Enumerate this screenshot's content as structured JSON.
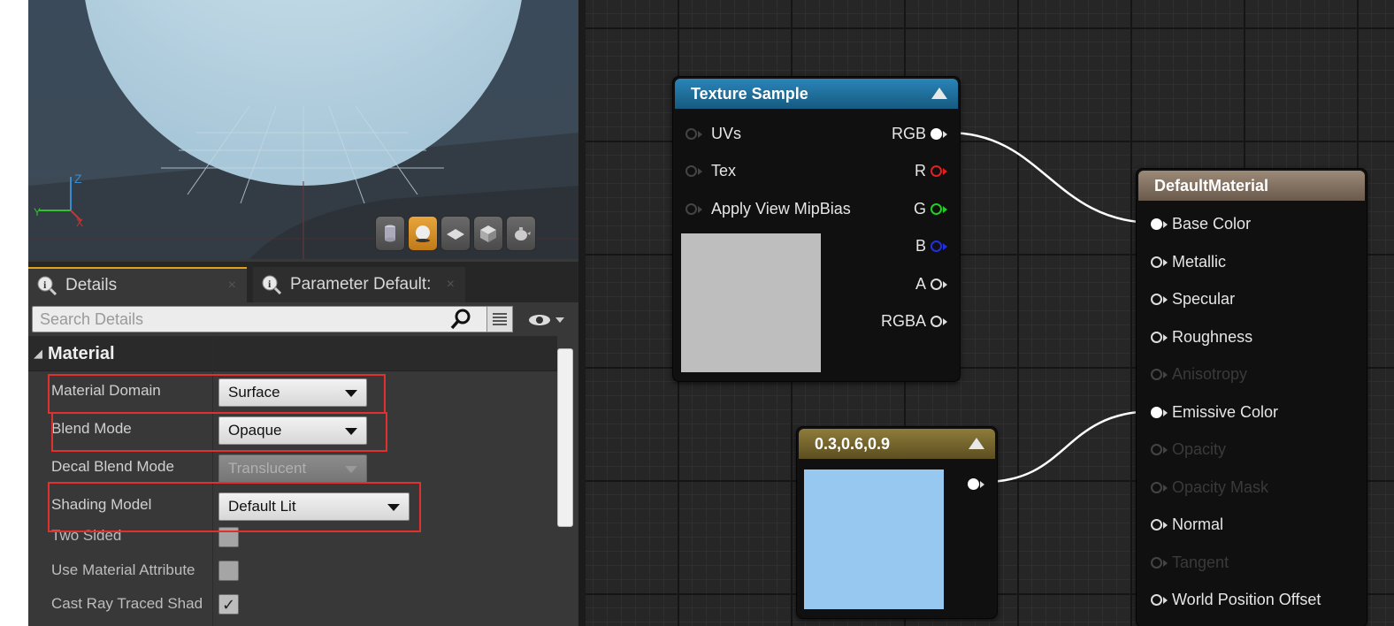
{
  "details_panel": {
    "tabs": [
      {
        "label": "Details"
      },
      {
        "label": "Parameter Default:"
      }
    ],
    "search": {
      "placeholder": "Search Details"
    },
    "section": {
      "title": "Material"
    },
    "properties": [
      {
        "label": "Material Domain",
        "value": "Surface",
        "highlighted": true
      },
      {
        "label": "Blend Mode",
        "value": "Opaque",
        "highlighted": true
      },
      {
        "label": "Decal Blend Mode",
        "value": "Translucent",
        "disabled": true
      },
      {
        "label": "Shading Model",
        "value": "Default Lit",
        "highlighted": true
      },
      {
        "label": "Two Sided",
        "checked": false
      },
      {
        "label": "Use Material Attribute",
        "checked": false
      },
      {
        "label": "Cast Ray Traced Shad",
        "checked": true
      }
    ],
    "highlight_color": "#e03030",
    "viewport_axes": {
      "z": "Z",
      "y": "Y",
      "x": "X"
    }
  },
  "nodes": {
    "texture_sample": {
      "title": "Texture Sample",
      "header_color": "#1f6f9a",
      "inputs": [
        "UVs",
        "Tex",
        "Apply View MipBias"
      ],
      "outputs": [
        {
          "label": "RGB",
          "color": "#ffffff"
        },
        {
          "label": "R",
          "color": "#e02020"
        },
        {
          "label": "G",
          "color": "#20d020"
        },
        {
          "label": "B",
          "color": "#2030e0"
        },
        {
          "label": "A",
          "color": "#d0d0d0"
        },
        {
          "label": "RGBA",
          "color": "#d0d0d0"
        }
      ],
      "preview_color": "#bebebe"
    },
    "constant": {
      "title": "0.3,0.6,0.9",
      "header_color": "#7a6a30",
      "preview_color": "#97c8f0"
    },
    "default_material": {
      "title": "DefaultMaterial",
      "header_color": "#8a7868",
      "inputs": [
        {
          "label": "Base Color",
          "state": "connected"
        },
        {
          "label": "Metallic",
          "state": "active"
        },
        {
          "label": "Specular",
          "state": "active"
        },
        {
          "label": "Roughness",
          "state": "active"
        },
        {
          "label": "Anisotropy",
          "state": "disabled"
        },
        {
          "label": "Emissive Color",
          "state": "connected"
        },
        {
          "label": "Opacity",
          "state": "disabled"
        },
        {
          "label": "Opacity Mask",
          "state": "disabled"
        },
        {
          "label": "Normal",
          "state": "active"
        },
        {
          "label": "Tangent",
          "state": "disabled"
        },
        {
          "label": "World Position Offset",
          "state": "active"
        }
      ]
    }
  }
}
